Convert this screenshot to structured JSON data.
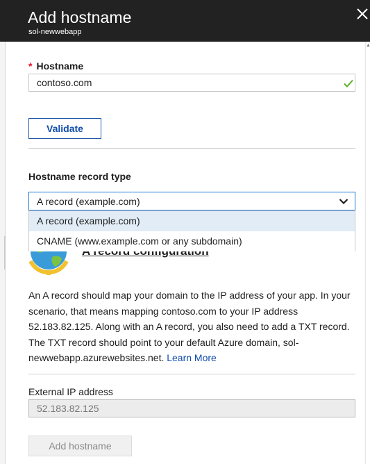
{
  "header": {
    "title": "Add hostname",
    "subtitle": "sol-newwebapp",
    "close_icon": "close-icon"
  },
  "hostname": {
    "required_mark": "*",
    "label": "Hostname",
    "value": "contoso.com",
    "status_icon": "check-icon",
    "status_color": "#5cb02c"
  },
  "validate_label": "Validate",
  "record_type": {
    "label": "Hostname record type",
    "selected": "A record (example.com)",
    "options": [
      "A record (example.com)",
      "CNAME (www.example.com or any subdomain)"
    ]
  },
  "a_record": {
    "title": "A record configuration",
    "icon": "globe-icon",
    "description": "An A record should map your domain to the IP address of your app. In your scenario, that means mapping contoso.com to your IP address 52.183.82.125. Along with an A record, you also need to add a TXT record. The TXT record should point to your default Azure domain, sol-newwebapp.azurewebsites.net.",
    "learn_more": "Learn More"
  },
  "external_ip": {
    "label": "External IP address",
    "value": "52.183.82.125"
  },
  "add_hostname_label": "Add hostname",
  "colors": {
    "header_bg": "#222222",
    "accent": "#0f4cad",
    "selected_option_bg": "#e1ecf6",
    "required": "#e81123"
  }
}
